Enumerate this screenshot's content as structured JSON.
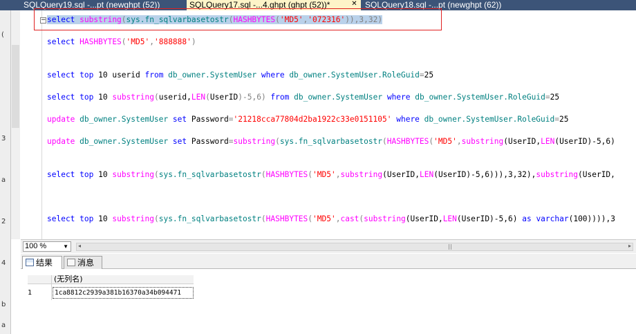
{
  "tabs": [
    {
      "label": "SQLQuery19.sql -...pt (newghpt (52))",
      "active": false
    },
    {
      "label": "SQLQuery17.sql -...4.ghpt (ghpt (52))*",
      "active": true
    },
    {
      "label": "SQLQuery18.sql -...pt (newghpt (62))",
      "active": false
    }
  ],
  "tab_close_glyph": "✕",
  "left_strip_chars": [
    "(",
    "3",
    "a",
    "2",
    "4",
    "b",
    "a"
  ],
  "editor": {
    "line1": {
      "p1": "select",
      "p2": " ",
      "p3": "substring",
      "p4": "(",
      "p5": "sys.fn_sqlvarbasetostr",
      "p6": "(",
      "p7": "HASHBYTES",
      "p8": "(",
      "p9": "'MD5'",
      "p10": ",",
      "p11": "'072316'",
      "p12": ")),3,32)"
    },
    "line2": {
      "p1": "select",
      "p2": " ",
      "p3": "HASHBYTES",
      "p4": "(",
      "p5": "'MD5'",
      "p6": ",",
      "p7": "'888888'",
      "p8": ")"
    },
    "line3": {
      "p1": "select",
      "p2": " ",
      "p3": "top",
      "p4": " 10 userid ",
      "p5": "from",
      "p6": " db_owner.SystemUser ",
      "p7": "where",
      "p8": " db_owner.SystemUser.RoleGuid",
      "p9": "=",
      "p10": "25"
    },
    "line4": {
      "p1": "select",
      "p2": " ",
      "p3": "top",
      "p4": " 10 ",
      "p5": "substring",
      "p6": "(",
      "p7": "userid,",
      "p8": "LEN",
      "p9": "(",
      "p10": "UserID",
      "p11": ")-5,6) ",
      "p12": "from",
      "p13": " db_owner.SystemUser ",
      "p14": "where",
      "p15": " db_owner.SystemUser.RoleGuid",
      "p16": "=",
      "p17": "25"
    },
    "line5": {
      "p1": "update",
      "p2": " db_owner.SystemUser ",
      "p3": "set",
      "p4": " Password",
      "p5": "=",
      "p6": "'21218cca77804d2ba1922c33e0151105'",
      "p7": " ",
      "p8": "where",
      "p9": " db_owner.SystemUser.RoleGuid",
      "p10": "=",
      "p11": "25"
    },
    "line6": {
      "p1": "update",
      "p2": " db_owner.SystemUser ",
      "p3": "set",
      "p4": " Password",
      "p5": "=",
      "p6": "substring",
      "p7": "(",
      "p8": "sys.fn_sqlvarbasetostr",
      "p9": "(",
      "p10": "HASHBYTES",
      "p11": "(",
      "p12": "'MD5'",
      "p13": ",",
      "p14": "substring",
      "p15": "(UserID,",
      "p16": "LEN",
      "p17": "(UserID)-5,6)"
    },
    "line7": {
      "p1": "select",
      "p2": " ",
      "p3": "top",
      "p4": " 10 ",
      "p5": "substring",
      "p6": "(",
      "p7": "sys.fn_sqlvarbasetostr",
      "p8": "(",
      "p9": "HASHBYTES",
      "p10": "(",
      "p11": "'MD5'",
      "p12": ",",
      "p13": "substring",
      "p14": "(UserID,",
      "p15": "LEN",
      "p16": "(UserID)-5,6))),3,32),",
      "p17": "substring",
      "p18": "(UserID,"
    },
    "line8": {
      "p1": "select",
      "p2": " ",
      "p3": "top",
      "p4": " 10 ",
      "p5": "substring",
      "p6": "(",
      "p7": "sys.fn_sqlvarbasetostr",
      "p8": "(",
      "p9": "HASHBYTES",
      "p10": "(",
      "p11": "'MD5'",
      "p12": ",",
      "p13": "cast",
      "p14": "(",
      "p15": "substring",
      "p16": "(UserID,",
      "p17": "LEN",
      "p18": "(UserID)-5,6) ",
      "p19": "as",
      "p20": " ",
      "p21": "varchar",
      "p22": "(100)))),3"
    }
  },
  "fold_glyph": "−",
  "zoom": {
    "value": "100 %",
    "dropdown": "▼"
  },
  "hscroll": {
    "left": "◂",
    "right": "▸"
  },
  "result_tabs": [
    {
      "label": "结果"
    },
    {
      "label": "消息"
    }
  ],
  "results": {
    "column_header": "(无列名)",
    "row_number": "1",
    "cell_value": "1ca8812c2939a381b16370a34b094471"
  }
}
